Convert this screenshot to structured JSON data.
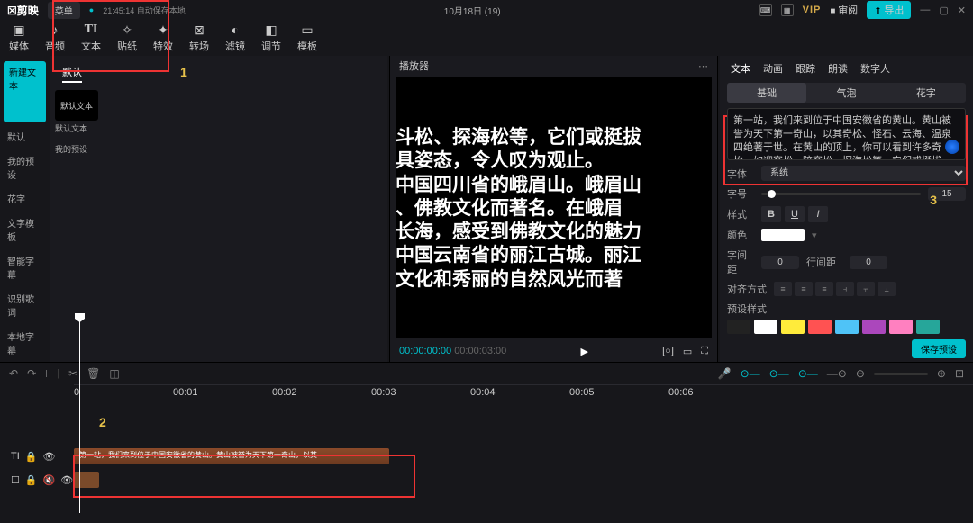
{
  "titlebar": {
    "logo": "☒剪映",
    "menu": "菜单",
    "autosave": "21:45:14 自动保存本地",
    "title": "10月18日 (19)",
    "vip": "VIP",
    "review": "审阅",
    "export": "导出"
  },
  "topTools": [
    {
      "icon": "▣",
      "label": "媒体"
    },
    {
      "icon": "♪",
      "label": "音频"
    },
    {
      "icon": "TI",
      "label": "文本",
      "active": true
    },
    {
      "icon": "✧",
      "label": "贴纸"
    },
    {
      "icon": "✦",
      "label": "特效"
    },
    {
      "icon": "�⊞",
      "label": "转场"
    },
    {
      "icon": "◐",
      "label": "滤镜"
    },
    {
      "icon": "◧",
      "label": "调节"
    },
    {
      "icon": "▭",
      "label": "模板"
    }
  ],
  "leftSide": [
    {
      "label": "新建文本",
      "sel": true
    },
    {
      "label": "默认"
    },
    {
      "label": "我的预设"
    },
    {
      "label": "花字"
    },
    {
      "label": "文字模板"
    },
    {
      "label": "智能字幕"
    },
    {
      "label": "识别歌词"
    },
    {
      "label": "本地字幕"
    }
  ],
  "leftTabs": {
    "a": "默认"
  },
  "leftCard": {
    "name": "默认文本",
    "preset": "我的预设"
  },
  "annot": {
    "n1": "1",
    "n2": "2",
    "n3": "3"
  },
  "player": {
    "title": "播放器",
    "lines": [
      "斗松、探海松等，它们或挺拔",
      "具姿态，令人叹为观止。",
      "中国四川省的峨眉山。峨眉山",
      "、佛教文化而著名。在峨眉",
      "长海，感受到佛教文化的魅力",
      "中国云南省的丽江古城。丽江",
      "文化和秀丽的自然风光而著"
    ],
    "cur": "00:00:00:00",
    "dur": "00:00:03:00"
  },
  "right": {
    "tabs": [
      "文本",
      "动画",
      "跟踪",
      "朗读",
      "数字人"
    ],
    "subtabs": [
      "基础",
      "气泡",
      "花字"
    ],
    "text": "第一站，我们来到位于中国安徽省的黄山。黄山被誉为天下第一奇山，以其奇松、怪石、云海、温泉四绝著于世。在黄山的顶上，你可以看到许多奇松，如迎客松、陪客松、探海松等，它们或挺拔、或蜿蜒、或倒挂，各具姿态，令人叹为观止。\n第二站，我们来到位于中国四川省的峨眉山。峨眉山是中国著名的佛教圣地",
    "fontLabel": "字体",
    "fontVal": "系统",
    "sizeLabel": "字号",
    "sizeVal": "15",
    "styleLabel": "样式",
    "colorLabel": "颜色",
    "spacingLabel": "字间距",
    "spacingVal": "0",
    "lineLabel": "行间距",
    "lineVal": "0",
    "alignLabel": "对齐方式",
    "presetLabel": "预设样式",
    "save": "保存预设"
  },
  "presetColors": [
    "#222",
    "#fff",
    "#ffeb3b",
    "#ff5252",
    "#4fc3f7",
    "#ab47bc",
    "#ff80c0",
    "#26a69a"
  ],
  "timeline": {
    "marks": [
      "0",
      "00:01",
      "00:02",
      "00:03",
      "00:04",
      "00:05",
      "00:06"
    ],
    "textclip": "第一站，我们来到位于中国安徽省的黄山。黄山被誉为天下第一奇山，以其",
    "trackLabels": {
      "t": "TI",
      "v": "☐"
    }
  }
}
